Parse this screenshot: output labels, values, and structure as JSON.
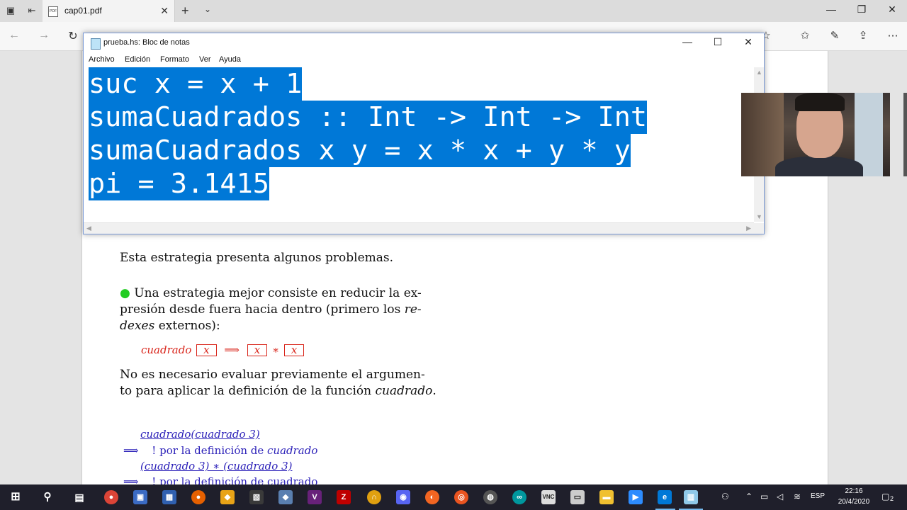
{
  "browser": {
    "tab_title": "cap01.pdf",
    "tab_favicon": "PDF"
  },
  "notepad": {
    "title": "prueba.hs: Bloc de notas",
    "menu": [
      "Archivo",
      "Edición",
      "Formato",
      "Ver",
      "Ayuda"
    ],
    "lines": [
      "suc x = x + 1",
      "sumaCuadrados :: Int -> Int -> Int",
      "sumaCuadrados x y = x * x + y * y",
      "pi = 3.1415"
    ]
  },
  "pdf": {
    "para1": "Esta estrategia presenta algunos problemas.",
    "bullet_line1": "Una estrategia mejor consiste en reducir la ex-",
    "bullet_line2": "presión desde fuera hacia dentro (primero los ",
    "bullet_line2_em": "re-",
    "bullet_line3_em": "dexes",
    "bullet_line3": " externos):",
    "formula_fn": "cuadrado",
    "formula_x": "x",
    "formula_arrow": "⟹",
    "formula_times": "∗",
    "para2_line1": "No es necesario evaluar previamente el argumen-",
    "para2_line2": "to para aplicar la definición de la función ",
    "para2_fn": "cuadrado",
    "para2_end": ".",
    "deriv_line1": "cuadrado(cuadrado 3)",
    "deriv_step1": "! por la definición de ",
    "deriv_step1_em": "cuadrado",
    "deriv_line2": "(cuadrado 3) ∗ (cuadrado 3)",
    "deriv_step2": "! por la definición de cuadrado"
  },
  "taskbar": {
    "language": "ESP",
    "time": "22:16",
    "date": "20/4/2020",
    "notifications": "2"
  }
}
